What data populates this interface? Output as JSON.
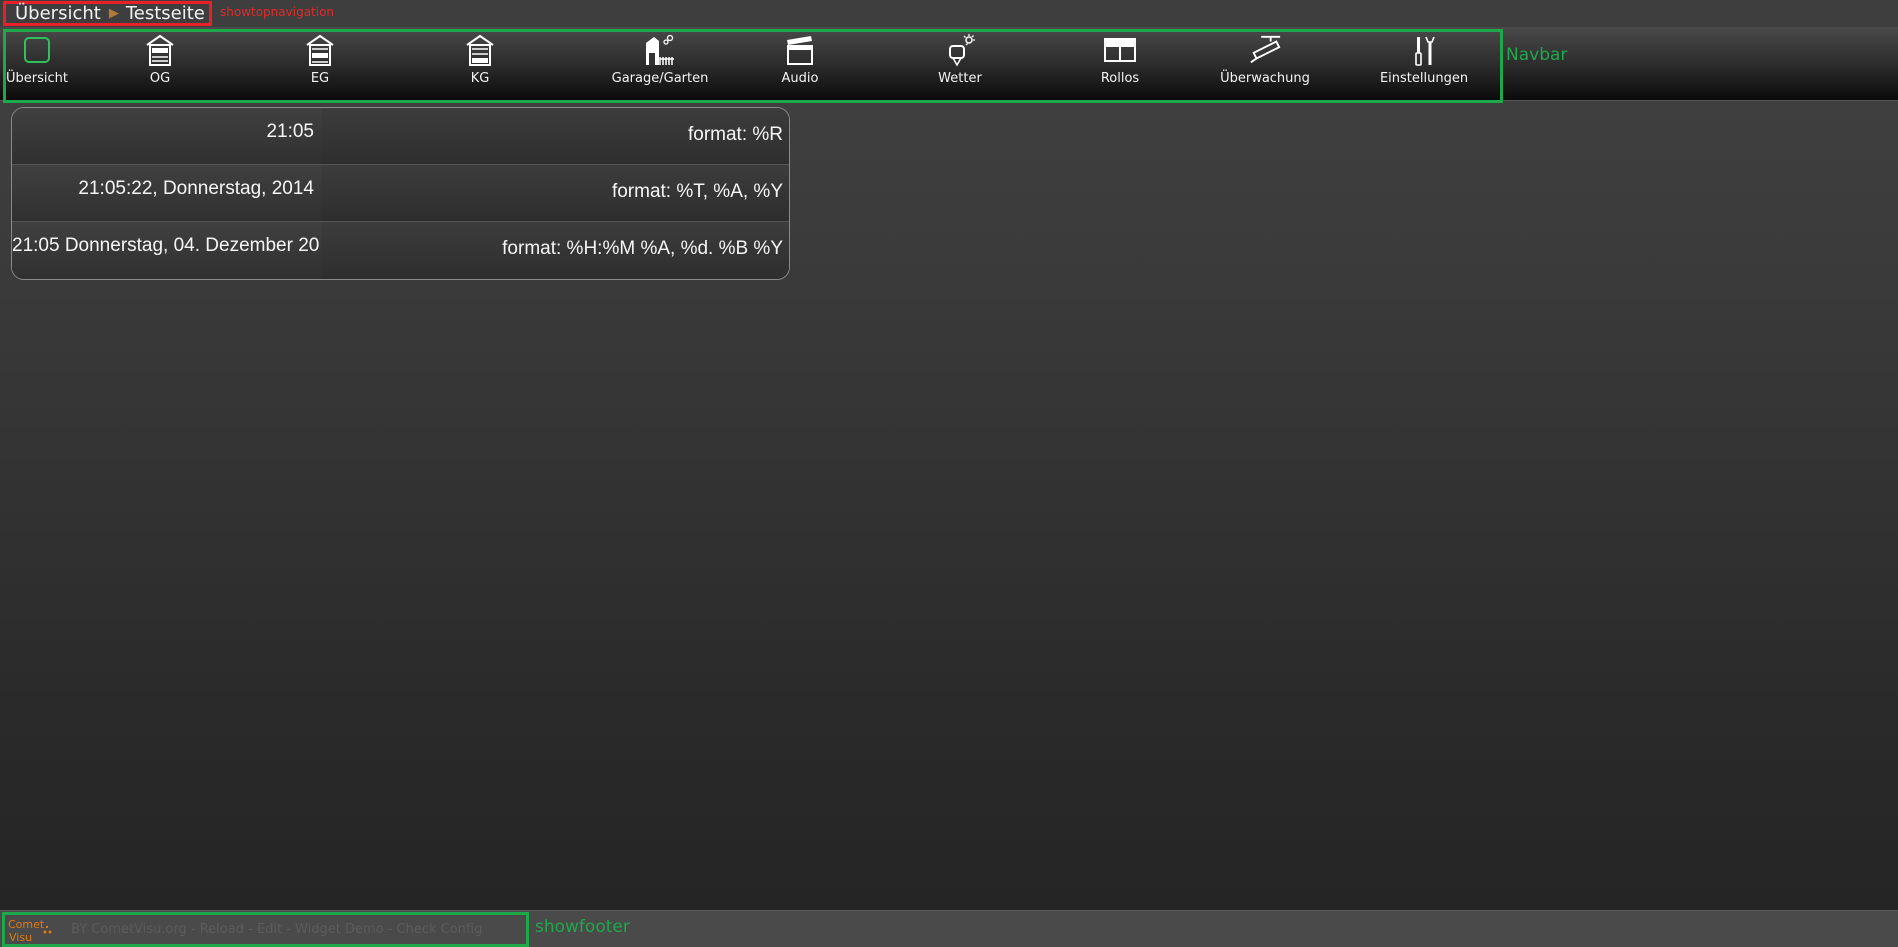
{
  "breadcrumb": {
    "items": [
      "Übersicht",
      "Testseite"
    ],
    "separator": "▶"
  },
  "annotations": {
    "topnav": "showtopnavigation",
    "navbar": "Navbar",
    "footer": "showfooter"
  },
  "navbar": {
    "items": [
      {
        "label": "Übersicht",
        "icon": "overview-square-icon"
      },
      {
        "label": "OG",
        "icon": "house-og-icon"
      },
      {
        "label": "EG",
        "icon": "house-eg-icon"
      },
      {
        "label": "KG",
        "icon": "house-kg-icon"
      },
      {
        "label": "Garage/Garten",
        "icon": "garage-garden-icon"
      },
      {
        "label": "Audio",
        "icon": "clapperboard-icon"
      },
      {
        "label": "Wetter",
        "icon": "weather-station-icon"
      },
      {
        "label": "Rollos",
        "icon": "window-blinds-icon"
      },
      {
        "label": "Überwachung",
        "icon": "security-camera-icon"
      },
      {
        "label": "Einstellungen",
        "icon": "tools-icon"
      }
    ]
  },
  "clock_rows": [
    {
      "value": "21:05",
      "format": "format: %R"
    },
    {
      "value": "21:05:22, Donnerstag, 2014",
      "format": "format: %T, %A, %Y"
    },
    {
      "value": "21:05 Donnerstag, 04. Dezember 20",
      "format": "format: %H:%M %A, %d. %B %Y"
    }
  ],
  "footer": {
    "logo_text": "Comet Visu",
    "links_text": "BY CometVisu.org - Reload - Edit - Widget Demo - Check Config"
  },
  "colors": {
    "annotation_red": "#e8202a",
    "annotation_green": "#1fa84a",
    "logo_orange": "#e07a10"
  }
}
